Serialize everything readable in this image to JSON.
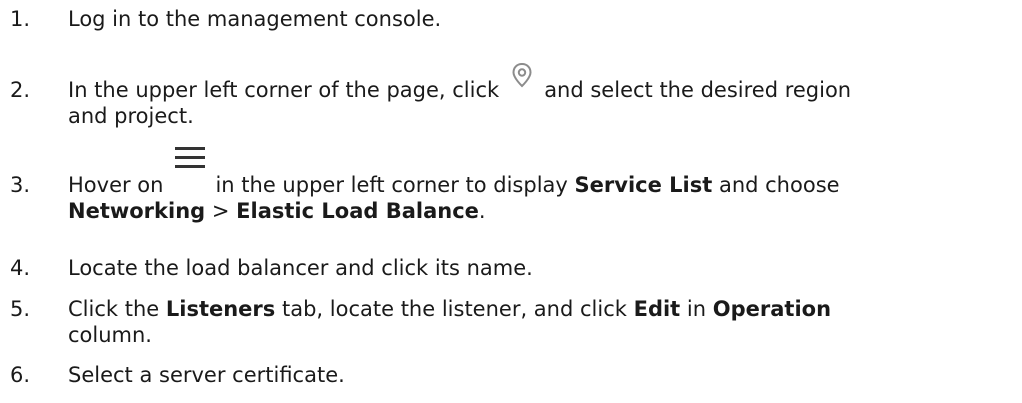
{
  "steps": [
    {
      "num": "1.",
      "text": "Log in to the management console."
    },
    {
      "num": "2.",
      "before": "In the upper left corner of the page, click",
      "icon": "location-pin-icon",
      "after": "and select the desired region",
      "line2": "and project."
    },
    {
      "num": "3.",
      "before": "Hover on",
      "icon": "hamburger-menu-icon",
      "mid": "in the upper left corner to display",
      "bold1": "Service List",
      "end": "and choose",
      "bold2": "Networking",
      "sep": ">",
      "bold3": "Elastic Load Balance",
      "period": "."
    },
    {
      "num": "4.",
      "text": "Locate the load balancer and click its name."
    },
    {
      "num": "5.",
      "t1": "Click the",
      "bold1": "Listeners",
      "t2": "tab, locate the listener, and click",
      "bold2": "Edit",
      "t3": "in",
      "bold3": "Operation",
      "line2": "column."
    },
    {
      "num": "6.",
      "text": "Select a server certificate."
    }
  ],
  "colors": {
    "text": "#1a1a1a",
    "icon_gray": "#8c8c8c",
    "icon_dark": "#333333"
  }
}
